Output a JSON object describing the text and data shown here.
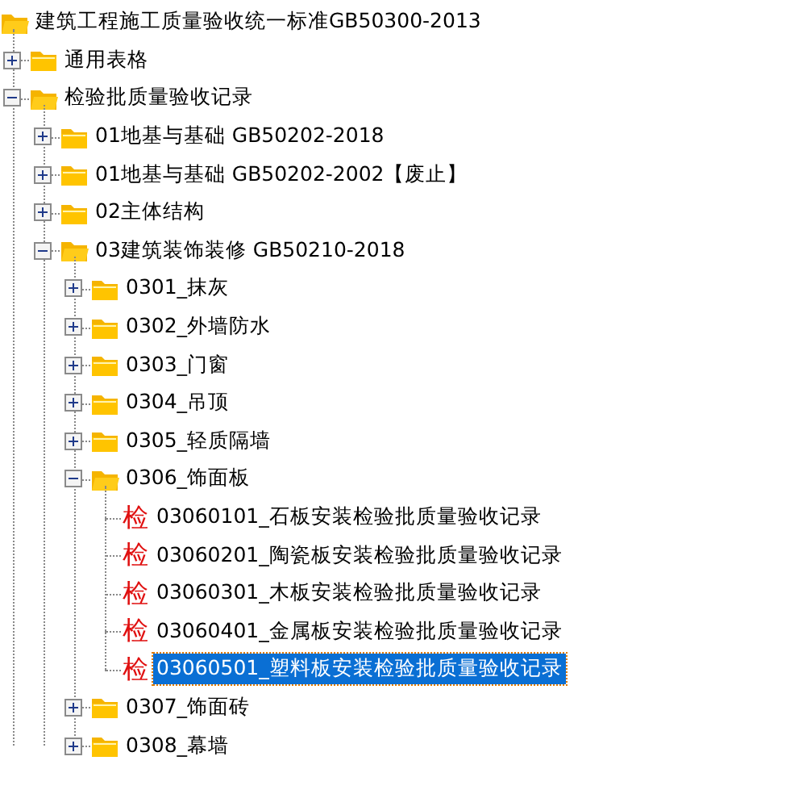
{
  "tree": [
    {
      "label": "建筑工程施工质量验收统一标准GB50300-2013",
      "kind": "folder",
      "expanded": true,
      "children": [
        {
          "label": "通用表格",
          "kind": "folder",
          "expanded": false
        },
        {
          "label": "检验批质量验收记录",
          "kind": "folder",
          "expanded": true,
          "children": [
            {
              "label": "01地基与基础 GB50202-2018",
              "kind": "folder",
              "expanded": false
            },
            {
              "label": "01地基与基础 GB50202-2002【废止】",
              "kind": "folder",
              "expanded": false
            },
            {
              "label": "02主体结构",
              "kind": "folder",
              "expanded": false
            },
            {
              "label": "03建筑装饰装修 GB50210-2018",
              "kind": "folder",
              "expanded": true,
              "children": [
                {
                  "label": "0301_抹灰",
                  "kind": "folder",
                  "expanded": false
                },
                {
                  "label": "0302_外墙防水",
                  "kind": "folder",
                  "expanded": false
                },
                {
                  "label": "0303_门窗",
                  "kind": "folder",
                  "expanded": false
                },
                {
                  "label": "0304_吊顶",
                  "kind": "folder",
                  "expanded": false
                },
                {
                  "label": "0305_轻质隔墙",
                  "kind": "folder",
                  "expanded": false
                },
                {
                  "label": "0306_饰面板",
                  "kind": "folder",
                  "expanded": true,
                  "children": [
                    {
                      "label": "03060101_石板安装检验批质量验收记录",
                      "kind": "record",
                      "icon_text": "检",
                      "selected": false
                    },
                    {
                      "label": "03060201_陶瓷板安装检验批质量验收记录",
                      "kind": "record",
                      "icon_text": "检",
                      "selected": false
                    },
                    {
                      "label": "03060301_木板安装检验批质量验收记录",
                      "kind": "record",
                      "icon_text": "检",
                      "selected": false
                    },
                    {
                      "label": "03060401_金属板安装检验批质量验收记录",
                      "kind": "record",
                      "icon_text": "检",
                      "selected": false
                    },
                    {
                      "label": "03060501_塑料板安装检验批质量验收记录",
                      "kind": "record",
                      "icon_text": "检",
                      "selected": true
                    }
                  ]
                },
                {
                  "label": "0307_饰面砖",
                  "kind": "folder",
                  "expanded": false
                },
                {
                  "label": "0308_幕墙",
                  "kind": "folder",
                  "expanded": false
                }
              ]
            }
          ]
        }
      ]
    }
  ]
}
